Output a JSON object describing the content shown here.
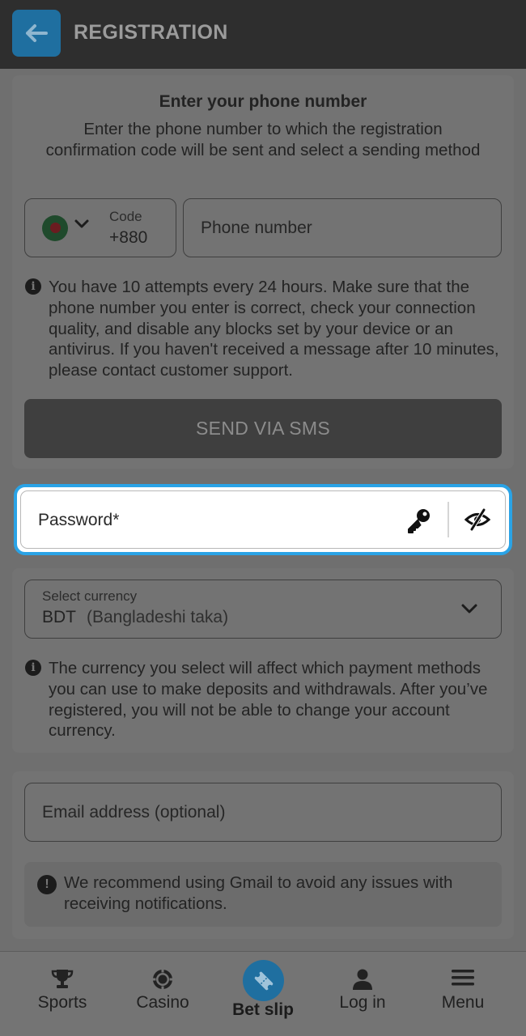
{
  "header": {
    "title": "REGISTRATION",
    "back_icon": "arrow-left-icon",
    "accent": "#1f6fa0"
  },
  "phone_section": {
    "title": "Enter your phone number",
    "description": "Enter the phone number to which the registration confirmation code will be sent and select a sending method",
    "code_label": "Code",
    "code_value": "+880",
    "phone_placeholder": "Phone number",
    "attempts_info": "You have 10 attempts every 24 hours. Make sure that the phone number you enter is correct, check your connection quality, and disable any blocks set by your device or an antivirus. If you haven't received a message after 10 minutes, please contact customer support.",
    "send_button": "SEND VIA SMS"
  },
  "password": {
    "label": "Password*",
    "focus_color": "#2aa3e6"
  },
  "currency": {
    "label": "Select currency",
    "code": "BDT",
    "name": "(Bangladeshi taka)",
    "info": "The currency you select will affect which payment methods you can use to make deposits and withdrawals. After you’ve registered, you will not be able to change your account currency."
  },
  "email": {
    "placeholder": "Email address (optional)",
    "notice": "We recommend using Gmail to avoid any issues with receiving notifications."
  },
  "bottom_nav": {
    "items": [
      {
        "label": "Sports",
        "icon": "trophy-icon"
      },
      {
        "label": "Casino",
        "icon": "casino-chip-icon"
      },
      {
        "label": "Bet slip",
        "icon": "ticket-icon"
      },
      {
        "label": "Log in",
        "icon": "user-icon"
      },
      {
        "label": "Menu",
        "icon": "hamburger-menu-icon"
      }
    ]
  }
}
